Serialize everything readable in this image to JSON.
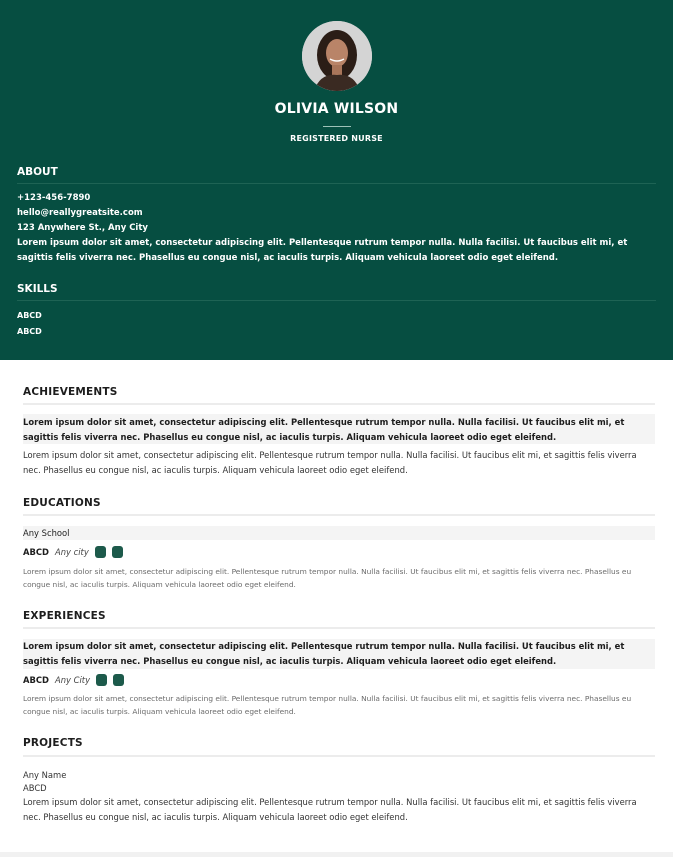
{
  "profile": {
    "name": "OLIVIA WILSON",
    "role": "REGISTERED NURSE"
  },
  "about": {
    "heading": "ABOUT",
    "phone": "+123-456-7890",
    "email": "hello@reallygreatsite.com",
    "address": "123 Anywhere St., Any City",
    "bio": "Lorem ipsum dolor sit amet, consectetur adipiscing elit. Pellentesque rutrum tempor nulla. Nulla facilisi. Ut faucibus elit mi, et sagittis felis viverra nec. Phasellus eu congue nisl, ac iaculis turpis. Aliquam vehicula laoreet odio eget eleifend."
  },
  "skills": {
    "heading": "SKILLS",
    "items": [
      "ABCD",
      "ABCD"
    ]
  },
  "achievements": {
    "heading": "ACHIEVEMENTS",
    "highlight": "Lorem ipsum dolor sit amet, consectetur adipiscing elit. Pellentesque rutrum tempor nulla. Nulla facilisi. Ut faucibus elit mi, et sagittis felis viverra nec. Phasellus eu congue nisl, ac iaculis turpis. Aliquam vehicula laoreet odio eget eleifend.",
    "text": "Lorem ipsum dolor sit amet, consectetur adipiscing elit. Pellentesque rutrum tempor nulla. Nulla facilisi. Ut faucibus elit mi, et sagittis felis viverra nec. Phasellus eu congue nisl, ac iaculis turpis. Aliquam vehicula laoreet odio eget eleifend."
  },
  "education": {
    "heading": "EDUCATIONS",
    "school": "Any School",
    "degree": "ABCD",
    "city": "Any city",
    "text": "Lorem ipsum dolor sit amet, consectetur adipiscing elit. Pellentesque rutrum tempor nulla. Nulla facilisi. Ut faucibus elit mi, et sagittis felis viverra nec. Phasellus eu congue nisl, ac iaculis turpis. Aliquam vehicula laoreet odio eget eleifend."
  },
  "experience": {
    "heading": "EXPERIENCES",
    "highlight": "Lorem ipsum dolor sit amet, consectetur adipiscing elit. Pellentesque rutrum tempor nulla. Nulla facilisi. Ut faucibus elit mi, et sagittis felis viverra nec. Phasellus eu congue nisl, ac iaculis turpis. Aliquam vehicula laoreet odio eget eleifend.",
    "degree": "ABCD",
    "city": "Any City",
    "text": "Lorem ipsum dolor sit amet, consectetur adipiscing elit. Pellentesque rutrum tempor nulla. Nulla facilisi. Ut faucibus elit mi, et sagittis felis viverra nec. Phasellus eu congue nisl, ac iaculis turpis. Aliquam vehicula laoreet odio eget eleifend."
  },
  "projects": {
    "heading": "PROJECTS",
    "name": "Any Name",
    "sub": "ABCD",
    "text": "Lorem ipsum dolor sit amet, consectetur adipiscing elit. Pellentesque rutrum tempor nulla. Nulla facilisi. Ut faucibus elit mi, et sagittis felis viverra nec. Phasellus eu congue nisl, ac iaculis turpis. Aliquam vehicula laoreet odio eget eleifend."
  },
  "colors": {
    "header_bg": "#064e41",
    "accent": "#1d5a4b"
  }
}
